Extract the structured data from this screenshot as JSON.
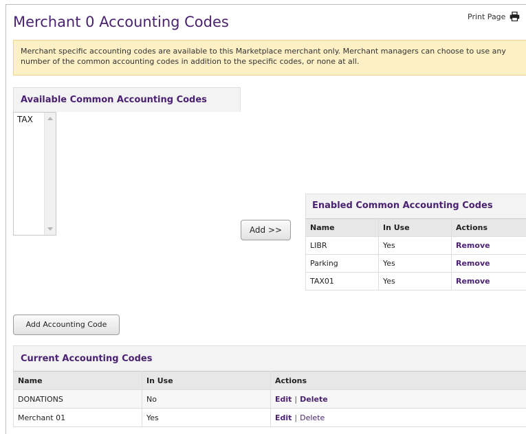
{
  "page": {
    "title": "Merchant 0 Accounting Codes",
    "print_label": "Print Page",
    "notice": "Merchant specific accounting codes are available to this Marketplace merchant only. Merchant managers can choose to use any number of the common accounting codes in addition to the specific codes, or none at all."
  },
  "available": {
    "heading": "Available Common Accounting Codes",
    "options": [
      "TAX"
    ]
  },
  "add_button": "Add >>",
  "enabled": {
    "heading": "Enabled Common Accounting Codes",
    "columns": [
      "Name",
      "In Use",
      "Actions"
    ],
    "rows": [
      {
        "name": "LIBR",
        "in_use": "Yes",
        "action": "Remove"
      },
      {
        "name": "Parking",
        "in_use": "Yes",
        "action": "Remove"
      },
      {
        "name": "TAX01",
        "in_use": "Yes",
        "action": "Remove"
      }
    ]
  },
  "add_code_button": "Add Accounting Code",
  "current": {
    "heading": "Current Accounting Codes",
    "columns": [
      "Name",
      "In Use",
      "Actions"
    ],
    "rows": [
      {
        "name": "DONATIONS",
        "in_use": "No",
        "edit": "Edit",
        "delete": "Delete"
      },
      {
        "name": "Merchant 01",
        "in_use": "Yes",
        "edit": "Edit",
        "delete": "Delete"
      }
    ],
    "separator": "|"
  },
  "colors": {
    "accent": "#4a2270",
    "notice_bg": "#fcf0c4",
    "header_bg": "#e7e7e7"
  },
  "icons": {
    "print": "printer-icon"
  }
}
